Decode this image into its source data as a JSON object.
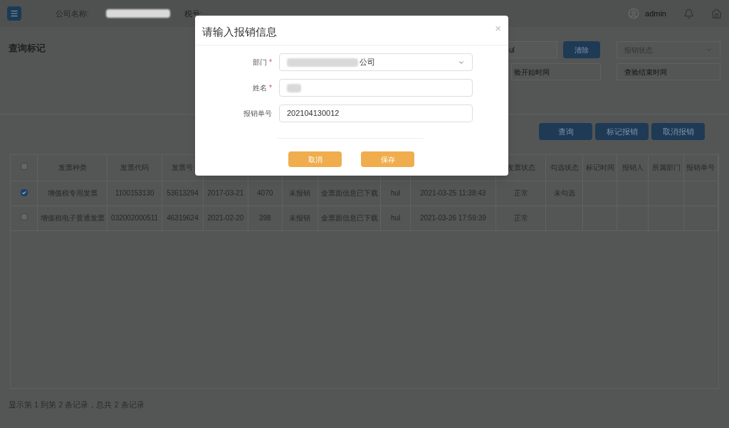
{
  "header": {
    "company_label": "公司名称:",
    "tax_label": "税号:",
    "user": "admin"
  },
  "page_title": "查询标记",
  "filters": {
    "keyword_value": "ul",
    "clear_button": "清除",
    "status_select": "报销状态",
    "start_placeholder": "验开始时间",
    "end_placeholder": "查验结束时间"
  },
  "actions": [
    "查询",
    "标记报销",
    "取消报销"
  ],
  "table": {
    "select_all_checked": false,
    "columns": [
      {
        "label": "发票种类"
      },
      {
        "label": "发票代码"
      },
      {
        "label": "发票号"
      },
      {},
      {},
      {},
      {},
      {},
      {},
      {
        "label": "发票状态"
      },
      {
        "label": "勾选状态"
      },
      {
        "label": "标记时间"
      },
      {
        "label": "报销人"
      },
      {
        "label": "所属部门"
      },
      {
        "label": "报销单号"
      }
    ],
    "rows": [
      {
        "checked": true,
        "cells": [
          "增值税专用发票",
          "1100153130",
          "53613294",
          "2017-03-21",
          "4070",
          "未报销",
          "全票面信息已下载",
          "hul",
          "2021-03-25 11:38:43",
          "正常",
          "未勾选",
          "",
          "",
          "",
          ""
        ]
      },
      {
        "checked": false,
        "cells": [
          "增值税电子普通发票",
          "032002000511",
          "46319624",
          "2021-02-20",
          "398",
          "未报销",
          "全票面信息已下载",
          "hul",
          "2021-03-26 17:59:39",
          "正常",
          "",
          "",
          "",
          "",
          ""
        ]
      }
    ]
  },
  "footer": "显示第 1 到第 2 条记录，总共 2 条记录",
  "dialog": {
    "title": "请输入报销信息",
    "close": "×",
    "required_mark": "*",
    "fields": [
      {
        "label": "部门",
        "required": true,
        "kind": "select",
        "value": "公司"
      },
      {
        "label": "姓名",
        "required": true,
        "kind": "text"
      },
      {
        "label": "报销单号",
        "required": false,
        "kind": "text",
        "value": "202104130012"
      }
    ],
    "buttons": [
      "取消",
      "保存"
    ]
  }
}
